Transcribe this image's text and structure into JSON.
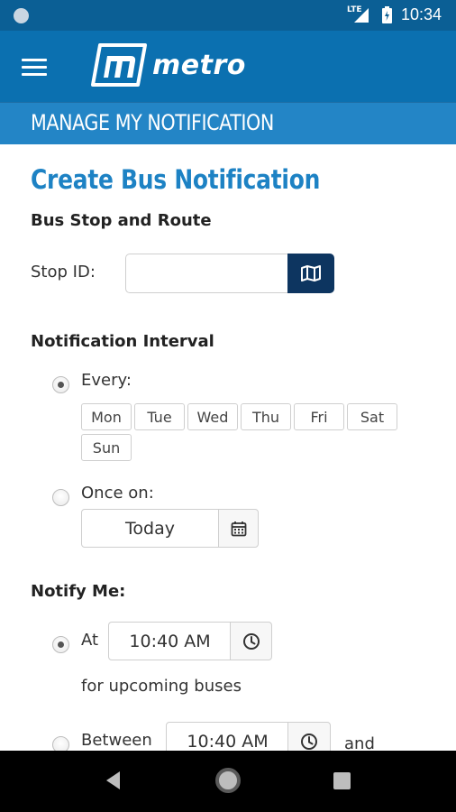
{
  "status_bar": {
    "network": "LTE",
    "time": "10:34"
  },
  "app_bar": {
    "brand": "metro"
  },
  "section_band": {
    "title": "MANAGE MY NOTIFICATION"
  },
  "form": {
    "title": "Create Bus Notification",
    "stop_section": {
      "heading": "Bus Stop and Route",
      "stop_id_label": "Stop ID:",
      "stop_id_value": "",
      "map_icon": "map-icon"
    },
    "interval_section": {
      "heading": "Notification Interval",
      "every_label": "Every:",
      "every_selected": true,
      "days": [
        "Mon",
        "Tue",
        "Wed",
        "Thu",
        "Fri",
        "Sat",
        "Sun"
      ],
      "once_label": "Once on:",
      "once_selected": false,
      "once_date": "Today",
      "calendar_icon": "calendar-icon"
    },
    "notify_section": {
      "heading": "Notify Me:",
      "at_label": "At",
      "at_selected": true,
      "at_time": "10:40 AM",
      "upcoming_text": "for upcoming buses",
      "between_label": "Between",
      "between_selected": false,
      "between_time": "10:40 AM",
      "and_label": "and",
      "clock_icon": "clock-icon"
    }
  },
  "nav_bar": {
    "back_icon": "back-triangle-icon",
    "home_icon": "home-circle-icon",
    "recents_icon": "recents-square-icon"
  },
  "colors": {
    "status_bar": "#0b5f95",
    "app_bar": "#0b70b0",
    "section_band": "#2385c6",
    "title_blue": "#1d82c4",
    "map_button": "#0d3560"
  }
}
